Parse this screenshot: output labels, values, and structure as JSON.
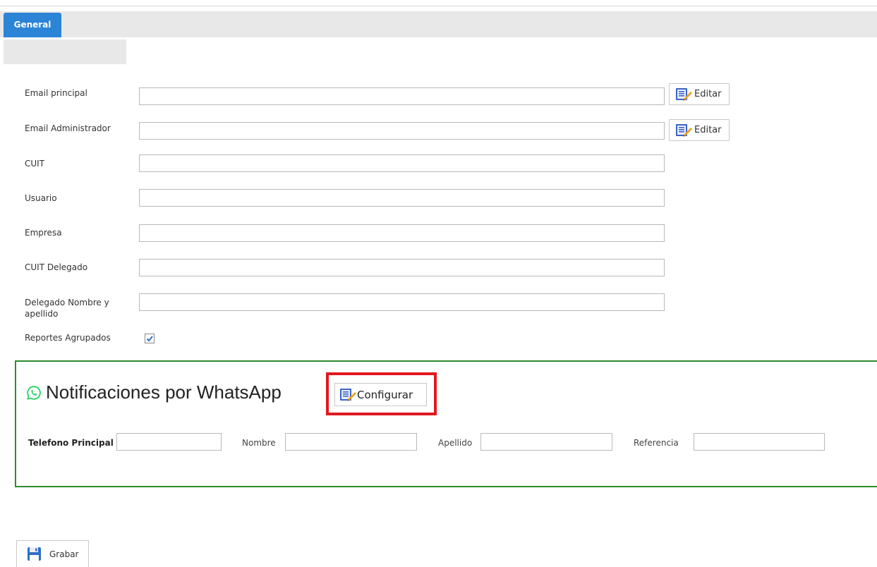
{
  "tabs": [
    {
      "label": "General",
      "active": true
    }
  ],
  "form": {
    "fields": [
      {
        "label": "Email principal",
        "value": "",
        "has_edit": true
      },
      {
        "label": "Email Administrador",
        "value": "",
        "has_edit": true
      },
      {
        "label": "CUIT",
        "value": ""
      },
      {
        "label": "Usuario",
        "value": ""
      },
      {
        "label": "Empresa",
        "value": ""
      },
      {
        "label": "CUIT Delegado",
        "value": ""
      },
      {
        "label": "Delegado Nombre y apellido",
        "value": ""
      }
    ],
    "edit_label": "Editar",
    "reportes_agrupados": {
      "label": "Reportes Agrupados",
      "checked": true
    }
  },
  "whatsapp": {
    "title": "Notificaciones por WhatsApp",
    "configure_label": "Configurar",
    "contact_fields": [
      {
        "label": "Telefono Principal",
        "value": ""
      },
      {
        "label": "Nombre",
        "value": ""
      },
      {
        "label": "Apellido",
        "value": ""
      },
      {
        "label": "Referencia",
        "value": ""
      }
    ]
  },
  "save_label": "Grabar",
  "colors": {
    "tab_active": "#2b84d6",
    "panel_border": "#2e8b2e",
    "highlight": "#e0191f",
    "whatsapp_green": "#25d366"
  },
  "icons": {
    "edit": "document-edit-icon",
    "whatsapp": "whatsapp-icon",
    "save": "floppy-disk-icon"
  }
}
